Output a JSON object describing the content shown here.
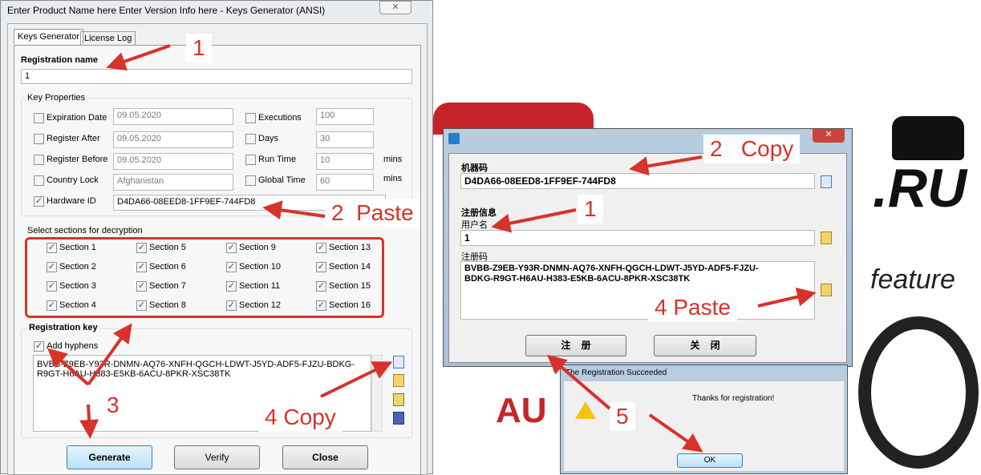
{
  "background": {
    "ru_text": ".RU",
    "feature_text": "feature",
    "brand_text": "AU"
  },
  "keygen": {
    "title": "Enter Product Name here Enter Version Info here - Keys Generator (ANSI)",
    "tabs": [
      "Keys Generator",
      "License Log"
    ],
    "reg_name_label": "Registration name",
    "reg_name_value": "1",
    "key_props_label": "Key Properties",
    "props": [
      {
        "label": "Expiration Date",
        "value": "09.05.2020",
        "checked": false
      },
      {
        "label": "Register After",
        "value": "09.05.2020",
        "checked": false
      },
      {
        "label": "Register Before",
        "value": "09.05.2020",
        "checked": false
      },
      {
        "label": "Country Lock",
        "value": "Afghanistan",
        "checked": false
      }
    ],
    "props2": [
      {
        "label": "Executions",
        "value": "100",
        "unit": ""
      },
      {
        "label": "Days",
        "value": "30",
        "unit": ""
      },
      {
        "label": "Run Time",
        "value": "10",
        "unit": "mins"
      },
      {
        "label": "Global Time",
        "value": "60",
        "unit": "mins"
      }
    ],
    "hwid_label": "Hardware ID",
    "hwid_value": "D4DA66-08EED8-1FF9EF-744FD8",
    "sections_label": "Select sections for decryption",
    "sections": [
      "Section 1",
      "Section 5",
      "Section 9",
      "Section 13",
      "Section 2",
      "Section 6",
      "Section 10",
      "Section 14",
      "Section 3",
      "Section 7",
      "Section 11",
      "Section 15",
      "Section 4",
      "Section 8",
      "Section 12",
      "Section 16"
    ],
    "reg_key_label": "Registration key",
    "add_hyphens": "Add hyphens",
    "reg_key_value": "BVBB-Z9EB-Y93R-DNMN-AQ76-XNFH-QGCH-LDWT-J5YD-ADF5-FJZU-BDKG-\nR9GT-H6AU-H383-E5KB-6ACU-8PKR-XSC38TK",
    "buttons": {
      "generate": "Generate",
      "verify": "Verify",
      "close": "Close"
    }
  },
  "regdlg": {
    "machine_label": "机器码",
    "machine_value": "D4DA66-08EED8-1FF9EF-744FD8",
    "info_label": "注册信息",
    "user_label": "用户名",
    "user_value": "1",
    "code_label": "注册码",
    "code_value": "BVBB-Z9EB-Y93R-DNMN-AQ76-XNFH-QGCH-LDWT-J5YD-ADF5-FJZU-\nBDKG-R9GT-H6AU-H383-E5KB-6ACU-8PKR-XSC38TK",
    "register": "注    册",
    "close": "关    闭"
  },
  "msgbox": {
    "title": "The Registration Succeeded",
    "text": "Thanks for registration!",
    "ok": "OK"
  },
  "annotations": {
    "n1a": "1",
    "n2a": "2  Paste",
    "n3": "3",
    "n4a": "4 Copy",
    "n2b": "2   Copy",
    "n1b": "1",
    "n4b": "4 Paste",
    "n5": "5"
  },
  "colors": {
    "annotation": "#d8322a",
    "highlight_box": "#d8322a"
  }
}
